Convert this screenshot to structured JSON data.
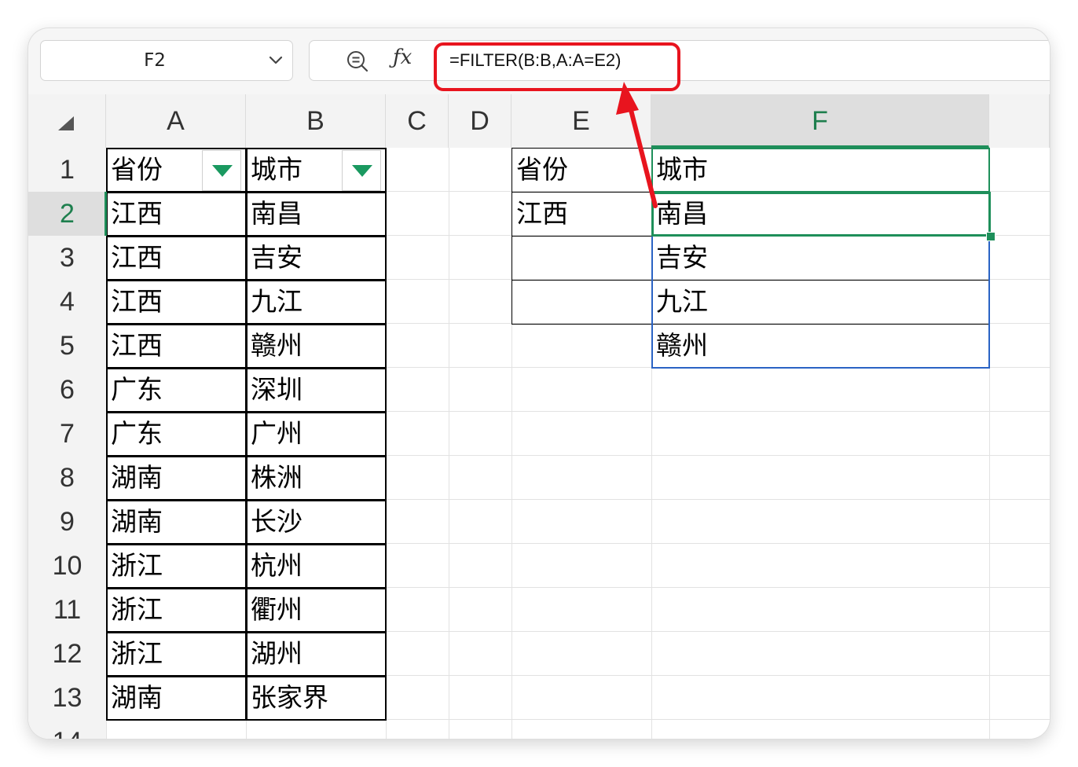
{
  "name_box": {
    "value": "F2"
  },
  "formula_bar": {
    "formula": "=FILTER(B:B,A:A=E2)"
  },
  "icons": {
    "zoom": "zoom-icon",
    "fx": "fx-icon",
    "dropdown": "chevron-down-icon",
    "filter": "filter-dropdown-icon"
  },
  "columns": [
    "A",
    "B",
    "C",
    "D",
    "E",
    "F"
  ],
  "rows": [
    "1",
    "2",
    "3",
    "4",
    "5",
    "6",
    "7",
    "8",
    "9",
    "10",
    "11",
    "12",
    "13",
    "14"
  ],
  "selection": {
    "column": "F",
    "row": "2"
  },
  "table_source": {
    "headers": [
      "省份",
      "城市"
    ],
    "rows": [
      [
        "江西",
        "南昌"
      ],
      [
        "江西",
        "吉安"
      ],
      [
        "江西",
        "九江"
      ],
      [
        "江西",
        "赣州"
      ],
      [
        "广东",
        "深圳"
      ],
      [
        "广东",
        "广州"
      ],
      [
        "湖南",
        "株洲"
      ],
      [
        "湖南",
        "长沙"
      ],
      [
        "浙江",
        "杭州"
      ],
      [
        "浙江",
        "衢州"
      ],
      [
        "浙江",
        "湖州"
      ],
      [
        "湖南",
        "张家界"
      ]
    ]
  },
  "table_lookup": {
    "header_e": "省份",
    "header_f": "城市",
    "criteria": "江西",
    "results": [
      "南昌",
      "吉安",
      "九江",
      "赣州"
    ]
  },
  "colors": {
    "accent_green": "#1e8f5a",
    "highlight_red": "#e8141e",
    "spill_blue": "#2a63c4",
    "filter_arrow": "#1a9960"
  }
}
